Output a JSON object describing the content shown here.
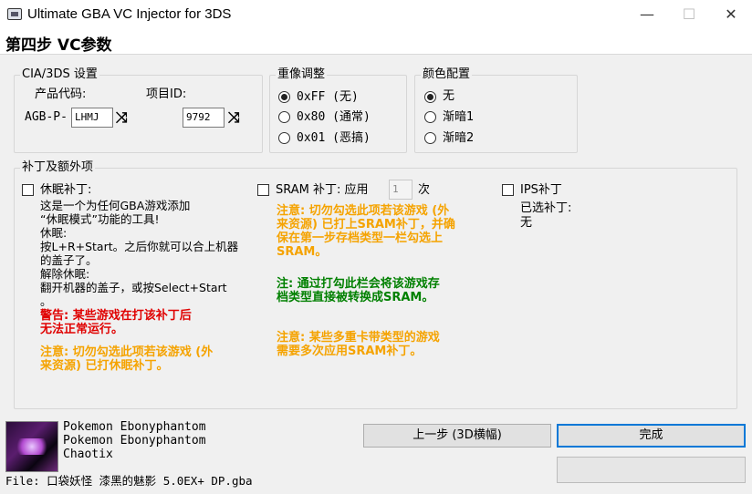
{
  "window": {
    "title": "Ultimate GBA VC Injector for 3DS",
    "minimize": "—",
    "maximize": "☐",
    "close": "✕"
  },
  "step_title": "第四步 VC参数",
  "cia_group": {
    "legend": "CIA/3DS 设置",
    "product_code_label": "产品代码:",
    "product_prefix": "AGB-P-",
    "product_code_value": "LHMJ",
    "project_id_label": "项目ID:",
    "project_id_value": "9792",
    "shuffle_icon": "⤨"
  },
  "rerender_group": {
    "legend": "重像调整",
    "options": [
      "0xFF (无)",
      "0x80 (通常)",
      "0x01 (恶搞)"
    ],
    "selected_index": 0
  },
  "color_group": {
    "legend": "颜色配置",
    "options": [
      "无",
      "渐暗1",
      "渐暗2"
    ],
    "selected_index": 0
  },
  "patch_group": {
    "legend": "补丁及额外项",
    "sleep": {
      "label": "休眠补丁:",
      "checked": false,
      "description": "这是一个为任何GBA游戏添加\n“休眠模式”功能的工具!\n休眠:\n按L+R+Start。之后你就可以合上机器\n的盖子了。\n解除休眠:\n翻开机器的盖子，或按Select+Start\n。",
      "warning_red": "警告: 某些游戏在打该补丁后\n无法正常运行。",
      "note_orange": "注意: 切勿勾选此项若该游戏 (外\n来资源) 已打休眠补丁。"
    },
    "sram": {
      "label": "SRAM 补丁: 应用",
      "times_value": "1",
      "times_suffix": "次",
      "checked": false,
      "note_orange_1": "注意: 切勿勾选此项若该游戏 (外\n来资源) 已打上SRAM补丁，并确\n保在第一步存档类型一栏勾选上\nSRAM。",
      "note_green": "注: 通过打勾此栏会将该游戏存\n档类型直接被转换成SRAM。",
      "note_orange_2": "注意: 某些多重卡带类型的游戏\n需要多次应用SRAM补丁。"
    },
    "ips": {
      "label": "IPS补丁",
      "checked": false,
      "selected_label": "已选补丁:",
      "selected_value": "无"
    }
  },
  "rom_info": {
    "line1": "Pokemon Ebonyphantom",
    "line2": "Pokemon Ebonyphantom",
    "line3": "Chaotix",
    "file": "File: 口袋妖怪 漆黑的魅影 5.0EX+ DP.gba"
  },
  "buttons": {
    "back": "上一步 (3D横幅)",
    "finish": "完成"
  },
  "colors": {
    "warning_red": "#e00000",
    "note_orange": "#f5a300",
    "note_green": "#008000",
    "focus_blue": "#0078d7"
  }
}
